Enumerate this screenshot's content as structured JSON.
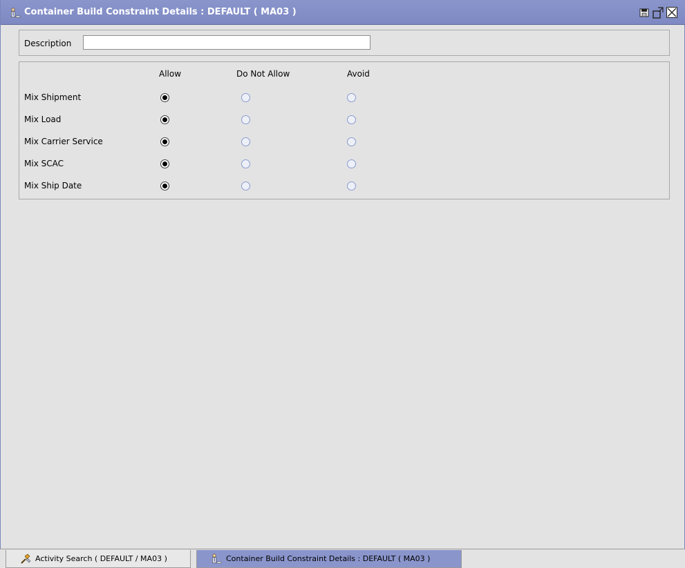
{
  "window": {
    "title": "Container Build Constraint Details : DEFAULT ( MA03 )",
    "icon": "user-icon",
    "controls": [
      "save-icon",
      "detach-icon",
      "close-icon"
    ]
  },
  "description": {
    "label": "Description",
    "value": "",
    "placeholder": ""
  },
  "options": {
    "columns": [
      "Allow",
      "Do Not Allow",
      "Avoid"
    ],
    "rows": [
      {
        "label": "Mix Shipment",
        "selected": "Allow"
      },
      {
        "label": "Mix Load",
        "selected": "Allow"
      },
      {
        "label": "Mix Carrier Service",
        "selected": "Allow"
      },
      {
        "label": "Mix SCAC",
        "selected": "Allow"
      },
      {
        "label": "Mix Ship Date",
        "selected": "Allow"
      }
    ]
  },
  "taskbar": {
    "tabs": [
      {
        "label": "Activity Search ( DEFAULT / MA03 )",
        "icon": "search-activity-icon",
        "active": false
      },
      {
        "label": "Container Build Constraint Details : DEFAULT ( MA03 )",
        "icon": "user-icon",
        "active": true
      }
    ]
  },
  "colors": {
    "titlebar": "#7e89c3",
    "background": "#e3e3e3",
    "active_tab": "#8a95cc"
  }
}
